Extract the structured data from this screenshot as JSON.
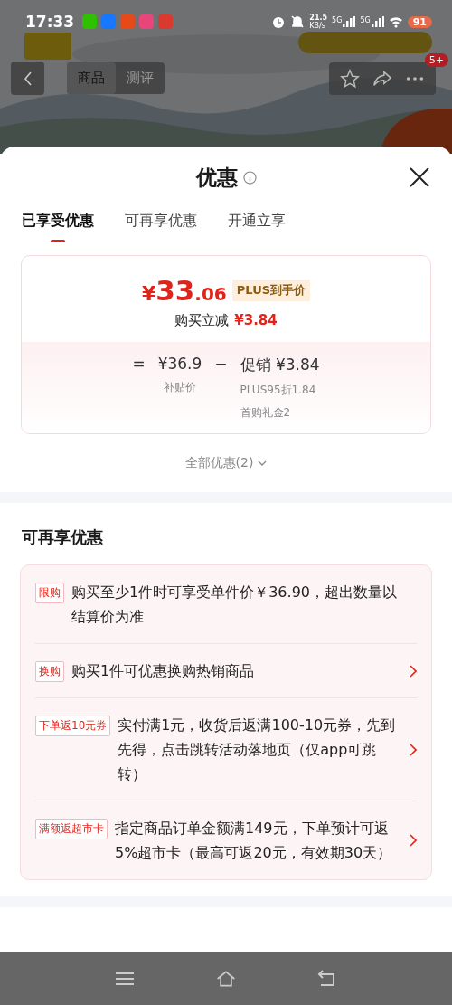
{
  "status_bar": {
    "time": "17:33",
    "net_speed": "21.5",
    "net_unit": "KB/s",
    "signals": [
      "5G",
      "5G"
    ],
    "battery": "91"
  },
  "nav": {
    "tabs": [
      {
        "label": "商品",
        "selected": true
      },
      {
        "label": "测评",
        "selected": false
      }
    ],
    "badge": "5+"
  },
  "sheet": {
    "title": "优惠",
    "tabs": [
      {
        "label": "已享受优惠",
        "selected": true
      },
      {
        "label": "可再享优惠",
        "selected": false
      },
      {
        "label": "开通立享",
        "selected": false
      }
    ],
    "price": {
      "currency": "¥",
      "integer": "33",
      "decimal": ".06",
      "tag": "PLUS到手价",
      "cut_label": "购买立减",
      "cut_value": "¥3.84"
    },
    "formula": {
      "equals": "=",
      "base": "¥36.9",
      "base_label": "补贴价",
      "minus": "−",
      "promo_label": "促销",
      "promo_value": "¥3.84",
      "promo_details": [
        "PLUS95折1.84",
        "首购礼金2"
      ]
    },
    "all_link": "全部优惠(2)",
    "more_title": "可再享优惠",
    "offers": [
      {
        "tag": "限购",
        "text": "购买至少1件时可享受单件价￥36.90，超出数量以结算价为准",
        "arrow": false
      },
      {
        "tag": "换购",
        "text": "购买1件可优惠换购热销商品",
        "arrow": true
      },
      {
        "tag": "下单返10元券",
        "text": "实付满1元，收货后返满100-10元券，先到先得，点击跳转活动落地页（仅app可跳转）",
        "arrow": true
      },
      {
        "tag": "满额返超市卡",
        "text": "指定商品订单金额满149元，下单预计可返5%超市卡（最高可返20元，有效期30天）",
        "arrow": true
      }
    ]
  }
}
